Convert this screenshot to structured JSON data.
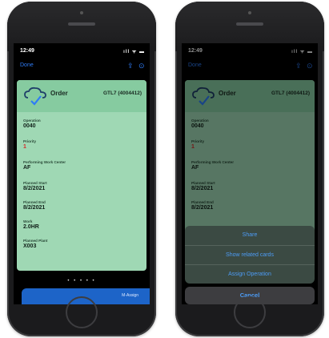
{
  "status": {
    "time": "12:49",
    "icons": "ıll ᯤ ▬"
  },
  "nav": {
    "done": "Done",
    "share_icon": "share-icon",
    "more_icon": "more-icon"
  },
  "card": {
    "title": "Order",
    "id": "GTL7 (4004412)",
    "fields": [
      {
        "label": "Operation",
        "value": "0040"
      },
      {
        "label": "Priority",
        "value": "1",
        "color": "#d62828"
      },
      {
        "label": "Performing Work Center",
        "value": "AF"
      },
      {
        "label": "Planned Start",
        "value": "8/2/2021"
      },
      {
        "label": "Planned End",
        "value": "8/2/2021"
      },
      {
        "label": "Work",
        "value": "2.0HR"
      },
      {
        "label": "Planned Plant",
        "value": "X003"
      }
    ]
  },
  "pager": "• • • • •",
  "bottom_band_label": "M-Assign",
  "action_sheet": {
    "items": [
      "Share",
      "Show related cards",
      "Assign Operation"
    ],
    "cancel": "Cancel"
  },
  "colors": {
    "card": "#9fd8b4",
    "accent": "#2f7cf6",
    "priority": "#d62828"
  }
}
